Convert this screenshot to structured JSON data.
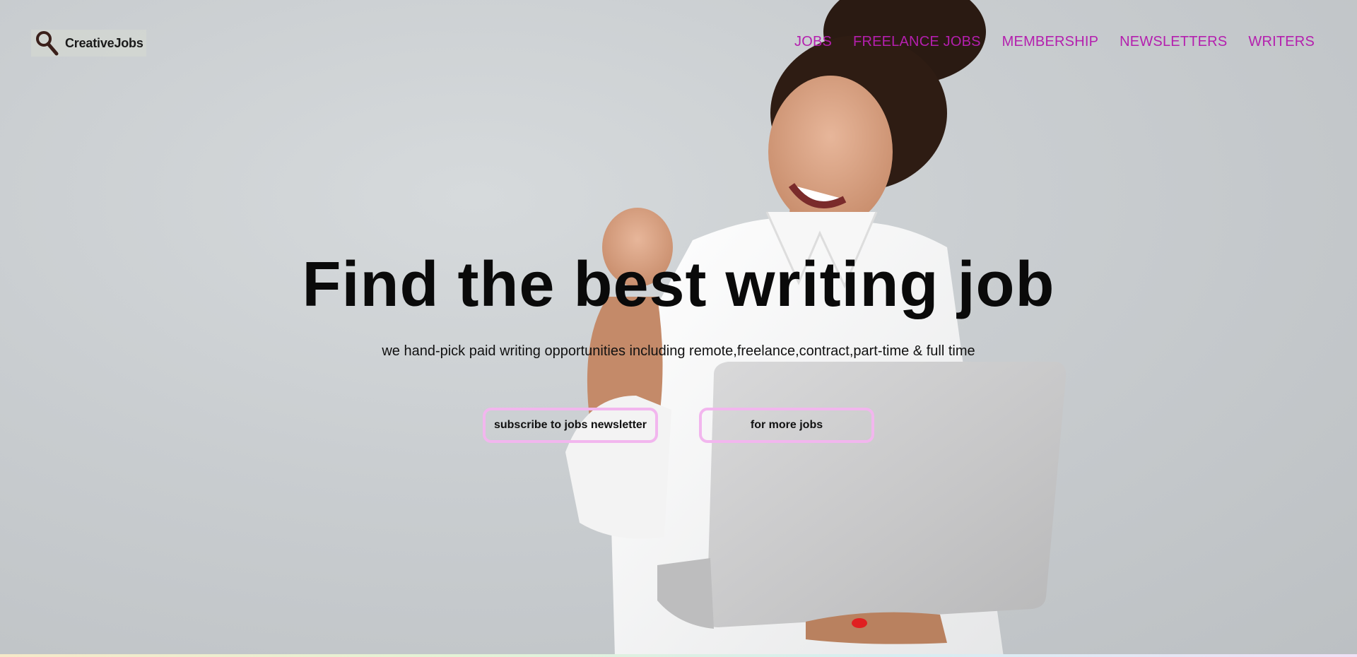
{
  "brand": {
    "name": "CreativeJobs",
    "icon": "magnifier-icon"
  },
  "nav": {
    "items": [
      {
        "label": "JOBS"
      },
      {
        "label": "FREELANCE JOBS"
      },
      {
        "label": "MEMBERSHIP"
      },
      {
        "label": "NEWSLETTERS"
      },
      {
        "label": "WRITERS"
      }
    ]
  },
  "hero": {
    "title": "Find the best writing job",
    "subtitle": "we hand-pick paid writing opportunities including remote,freelance,contract,part-time & full time",
    "buttons": {
      "subscribe": "subscribe to jobs newsletter",
      "more": "for more jobs"
    }
  },
  "colors": {
    "nav_link": "#b41fae",
    "button_border": "#f2b6ee",
    "background": "#c9cdd0"
  }
}
